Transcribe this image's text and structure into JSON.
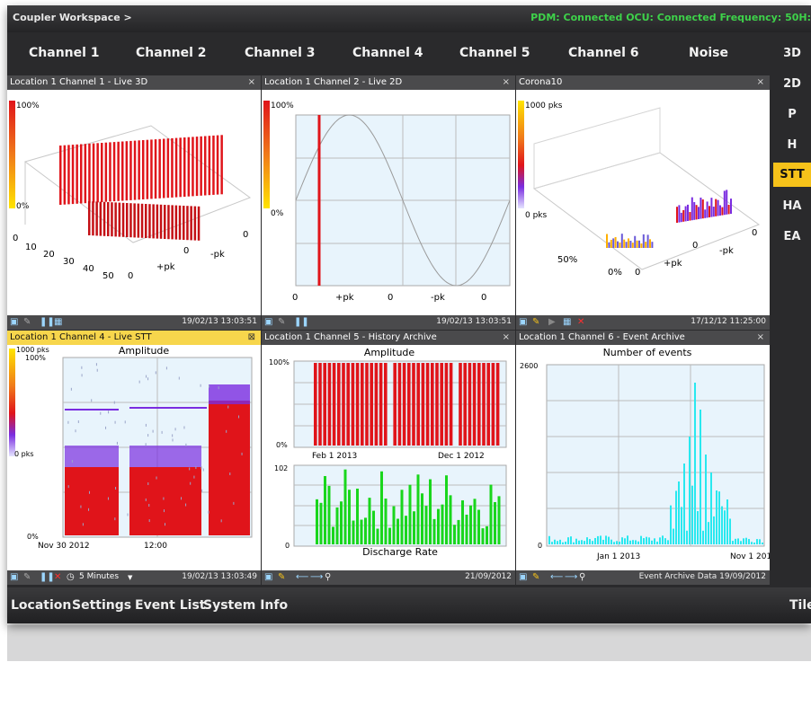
{
  "app": {
    "title": "Coupler Workspace >",
    "status": "PDM: Connected OCU: Connected Frequency: 50H:"
  },
  "channel_tabs": [
    "Channel 1",
    "Channel 2",
    "Channel 3",
    "Channel 4",
    "Channel 5",
    "Channel 6",
    "Noise"
  ],
  "view_modes": [
    "3D",
    "2D",
    "P",
    "H",
    "STT",
    "HA",
    "EA"
  ],
  "active_view": "STT",
  "panels": [
    {
      "title": "Location  1 Channel 1 - Live 3D",
      "close": "×",
      "scale_top": "100%",
      "scale_bottom": "0%",
      "depth_ticks": [
        "0",
        "10",
        "20",
        "30",
        "40",
        "50"
      ],
      "floor_labels": [
        "0",
        "+pk",
        "0",
        "-pk",
        "0"
      ],
      "timestamp": "19/02/13 13:03:51"
    },
    {
      "title": "Location  1 Channel 2 - Live 2D",
      "close": "×",
      "scale_top": "100%",
      "scale_bottom": "0%",
      "x_ticks": [
        "0",
        "+pk",
        "0",
        "-pk",
        "0"
      ],
      "timestamp": "19/02/13 13:03:51"
    },
    {
      "title": "Corona10",
      "close": "×",
      "scale_top": "1000 pks",
      "scale_bottom": "0 pks",
      "depth_ticks": [
        "50%",
        "0%"
      ],
      "floor_labels": [
        "0",
        "+pk",
        "0",
        "-pk",
        "0"
      ],
      "timestamp": "17/12/12 11:25:00"
    },
    {
      "title": "Location  1 Channel 4 - Live STT",
      "close": "⊠",
      "scale_top": "1000 pks",
      "y_top": "100%",
      "y_mid": "0 pks",
      "y_bottom": "0%",
      "chart_title": "Amplitude",
      "x_start": "Nov 30 2012",
      "x_mid": "12:00",
      "window_label": "5 Minutes",
      "timestamp": "19/02/13 13:03:49"
    },
    {
      "title": "Location  1 Channel 5 - History Archive",
      "close": "×",
      "chart_title": "Amplitude",
      "y_top": "100%",
      "y_bottom": "0%",
      "x_start": "Feb 1 2013",
      "x_end": "Dec 1 2012",
      "y2_top": "102",
      "y2_bottom": "0",
      "chart2_title": "Discharge Rate",
      "timestamp": "21/09/2012"
    },
    {
      "title": "Location  1 Channel 6 - Event Archive",
      "close": "×",
      "chart_title": "Number of events",
      "y_top": "2600",
      "y_bottom": "0",
      "x_start": "Jan 1 2013",
      "x_end": "Nov 1 201",
      "timestamp": "Event Archive Data 19/09/2012"
    }
  ],
  "footer": {
    "items": [
      "Location",
      "Settings",
      "Event List",
      "System Info"
    ],
    "right": "Tile"
  },
  "colors": {
    "accent": "#f6c21a",
    "status_green": "#3ed24a",
    "panel_header": "#4a4a4c",
    "plot_bg": "#e8f4fc",
    "red": "#e0141a",
    "green": "#19d61c",
    "cyan": "#29e8ef"
  }
}
